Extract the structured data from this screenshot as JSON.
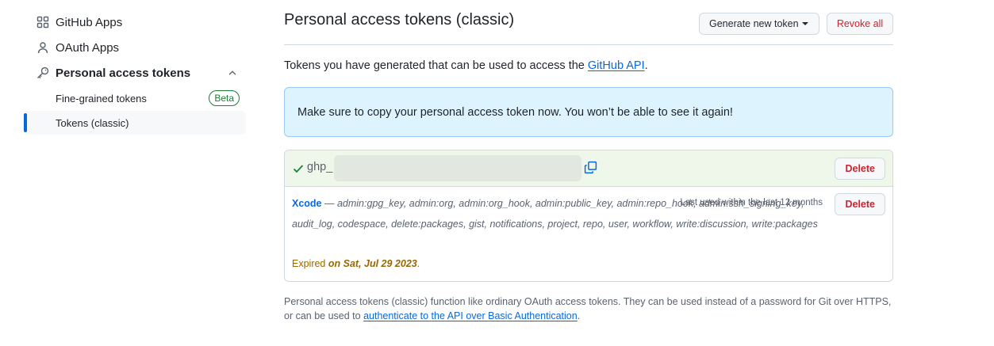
{
  "sidebar": {
    "items": [
      {
        "label": "GitHub Apps",
        "icon": "apps-icon"
      },
      {
        "label": "OAuth Apps",
        "icon": "person-icon"
      },
      {
        "label": "Personal access tokens",
        "icon": "key-icon"
      }
    ],
    "subitems": [
      {
        "label": "Fine-grained tokens",
        "badge": "Beta"
      },
      {
        "label": "Tokens (classic)",
        "active": true
      }
    ]
  },
  "header": {
    "title": "Personal access tokens (classic)",
    "generate_label": "Generate new token",
    "revoke_label": "Revoke all"
  },
  "intro": {
    "text": "Tokens you have generated that can be used to access the ",
    "link": "GitHub API",
    "suffix": "."
  },
  "flash": {
    "text": "Make sure to copy your personal access token now. You won’t be able to see it again!"
  },
  "new_token": {
    "prefix": "ghp_",
    "delete_label": "Delete"
  },
  "token": {
    "name": "Xcode",
    "separator": " — ",
    "scopes": "admin:gpg_key, admin:org, admin:org_hook, admin:public_key, admin:repo_hook, admin:ssh_signing_key, audit_log, codespace, delete:packages, gist, notifications, project, repo, user, workflow, write:discussion, write:packages",
    "last_used": "Last used within the last 12 months",
    "expired_prefix": "Expired ",
    "expired_date": "on Sat, Jul 29 2023",
    "expired_suffix": ".",
    "delete_label": "Delete"
  },
  "footnote": {
    "text": "Personal access tokens (classic) function like ordinary OAuth access tokens. They can be used instead of a password for Git over HTTPS, or can be used to ",
    "link": "authenticate to the API over Basic Authentication",
    "suffix": "."
  },
  "colors": {
    "accent": "#0969da",
    "danger": "#cf222e",
    "success": "#1a7f37",
    "attention": "#9a6700"
  }
}
